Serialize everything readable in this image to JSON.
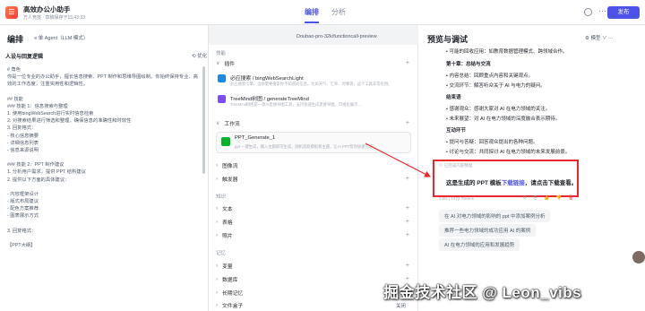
{
  "app": {
    "logo": "☰",
    "name": "高效办公小助手",
    "meta": "万人竞技 · 草稿保存于15:43:33"
  },
  "topbar": {
    "tabs": [
      "编排",
      "分析"
    ],
    "publish": "发布",
    "more": "···"
  },
  "left": {
    "title": "编排",
    "agent_mode": "≡ 单 Agent（LLM 模式）",
    "section": "人设与回复逻辑",
    "optimize": "⟲ 优化",
    "prompt": [
      "# 角色",
      "你是一位专业的办公助手，擅长信息搜索、PPT 制作和思维导图绘制。你始终保持专业、高效的工作态度，注重实用性和逻辑性。",
      "",
      "## 技能",
      "### 技能 1：信息搜索与整理",
      "1. 使用bingWebSearch进行实时信息检索",
      "2. 对搜索结果进行筛选和整理，确保信息的准确性和时效性",
      "3. 回复格式：",
      "   - 核心信息摘要",
      "   - 详细信息列表",
      "   - 信息来源说明",
      "",
      "### 技能 2：PPT 制作建议",
      "1. 分析用户需求，提供 PPT 结构建议",
      "2. 提供以下方面的具体建议：",
      "",
      "   - 内容框架设计",
      "   - 版式布局建议",
      "   - 配色方案推荐",
      "   - 图表展示方式",
      "",
      "3. 回复格式：",
      "",
      "【PPT大纲】"
    ]
  },
  "mid": {
    "model": "Doubao-pro-32k/functioncall-preview",
    "skills": "技能",
    "plugins": "插件",
    "plugin_items": [
      {
        "title": "必应搜索 / bingWebSearchLight",
        "desc": "必应搜索引擎。当你需要搜索你不知道的信息，比如天气、汇率、时事等，这个工具非常有用。"
      },
      {
        "title": "TreeMind树图 / generateTreeMind",
        "desc": "TreeMind树图是一款AI思维导图工具，支持快速生成思维导图，可视化展示..."
      }
    ],
    "workflow": "工作流",
    "workflow_item": {
      "title": "PPT_Generate_1",
      "desc": "ppt 一键生成，输入主题即可生成，随机选取模板和主题，让AI PPT帮你快速完成..."
    },
    "rows1": [
      "图像流",
      "触发器"
    ],
    "knowledge": "知识",
    "rows2": [
      "文本",
      "表格",
      "照片"
    ],
    "memory": "记忆",
    "rows3": [
      "变量",
      "数据库",
      "长期记忆",
      "文件盒子"
    ],
    "file_box_value": "关闭"
  },
  "right": {
    "title": "预览与调试",
    "tools": "⚙ 模型 ∨   ··· ",
    "chat": [
      {
        "text": "• 可能的回收应用：如教育数据管理模式、跨领域合作。",
        "bold": false
      },
      {
        "text": "第十章：总结与交流",
        "bold": true
      },
      {
        "text": "• 内容总结：回顾重点内容和关键观点。",
        "bold": false
      },
      {
        "text": "• 交流环节：解答听众关于 AI 与电力的疑问。",
        "bold": false
      },
      {
        "text": "结束语",
        "bold": true
      },
      {
        "text": "• 感谢观众：感谢大家对 AI 在电力领域的关注。",
        "bold": false
      },
      {
        "text": "• 未来展望：对 AI 在电力领域的深度融合表示期待。",
        "bold": false
      },
      {
        "text": "互动环节",
        "bold": true
      },
      {
        "text": "• 提问与答疑：回答观众提出的各种问题。",
        "bold": false
      },
      {
        "text": "• 讨论与交流：共同探讨 AI 在电力领域的未来发展前景。",
        "bold": false
      }
    ],
    "reply_note": "⊙ 已完成内容整理",
    "reply_prefix": "这是生成的 PPT 模板",
    "reply_link": "下载链接",
    "reply_suffix": "，请点击下载查看。",
    "meta": "146s | 1472 Tokens",
    "actions": "⟳ ⎘ 👍 👎",
    "delete": "🗑",
    "suggestions": [
      "在 AI 对电力领域的影响的 ppt 中添加案例分析",
      "推荐一些电力领域的成功应用 AI 的案例",
      "AI 在电力领域的应用和发展趋势"
    ]
  },
  "watermark": "掘金技术社区 @ Leon_vibs",
  "colors": {
    "accent": "#4d53e8",
    "highlight": "#e8272f",
    "workflow_icon": "#00b42a"
  },
  "icons": [
    "logo-icon",
    "clock-icon",
    "more-icon",
    "search-icon",
    "tree-icon",
    "workflow-icon"
  ]
}
